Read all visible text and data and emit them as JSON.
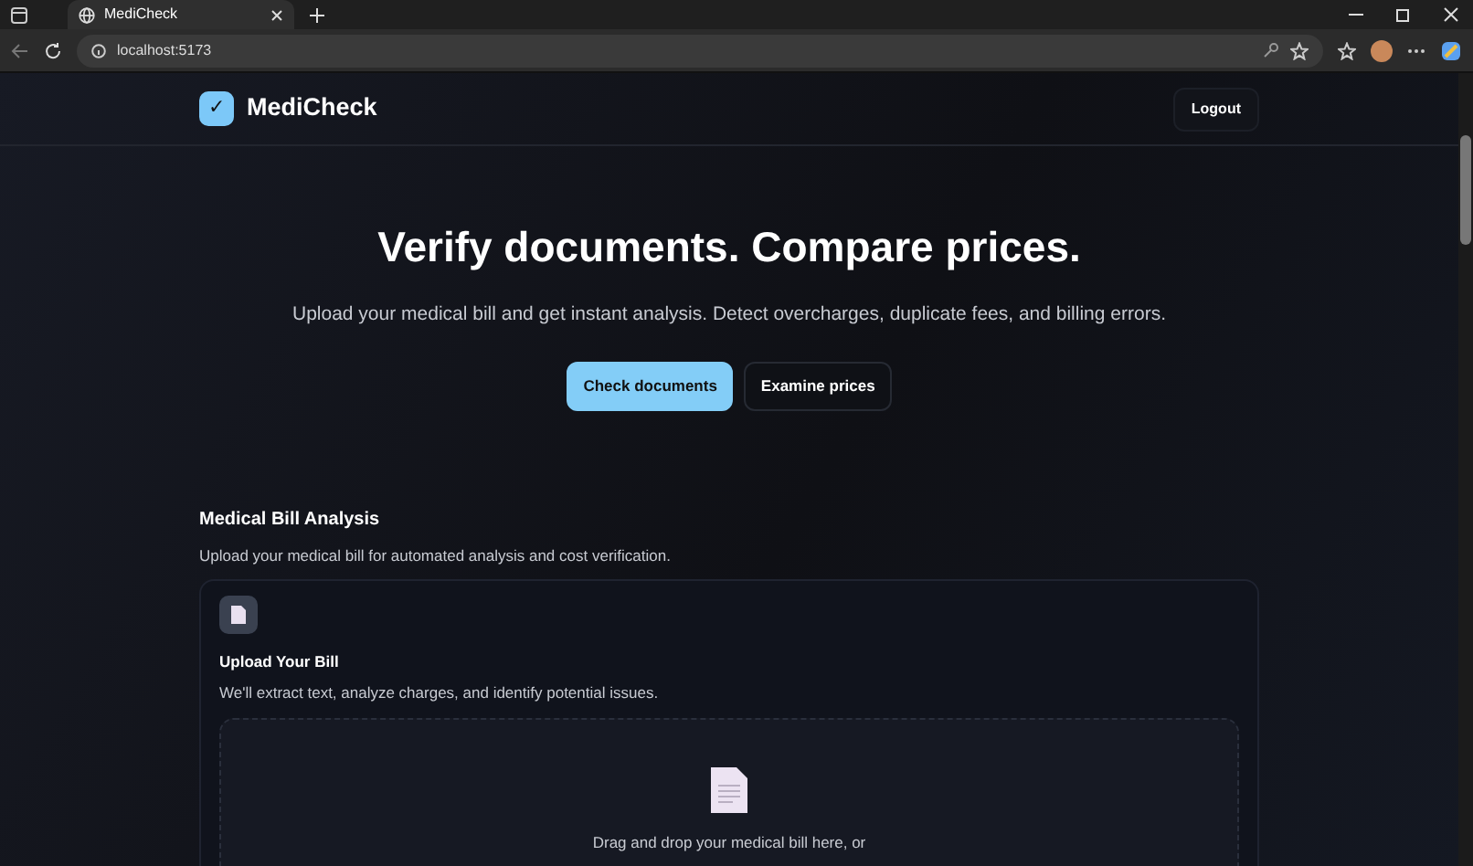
{
  "browser": {
    "tab_title": "MediCheck",
    "address": "localhost:5173"
  },
  "header": {
    "brand_mark": "✓",
    "brand": "MediCheck",
    "logout": "Logout"
  },
  "hero": {
    "title": "Verify documents. Compare prices.",
    "subtitle": "Upload your medical bill and get instant analysis. Detect overcharges, duplicate fees, and billing errors.",
    "buttons": [
      {
        "label": "Check documents",
        "kind": "primary"
      },
      {
        "label": "Examine prices",
        "kind": "outline"
      }
    ]
  },
  "section": {
    "title": "Medical Bill Analysis",
    "description": "Upload your medical bill for automated analysis and cost verification.",
    "card": {
      "title": "Upload Your Bill",
      "description": "We'll extract text, analyze charges, and identify potential issues.",
      "dropzone_text": "Drag and drop your medical bill here, or"
    }
  }
}
